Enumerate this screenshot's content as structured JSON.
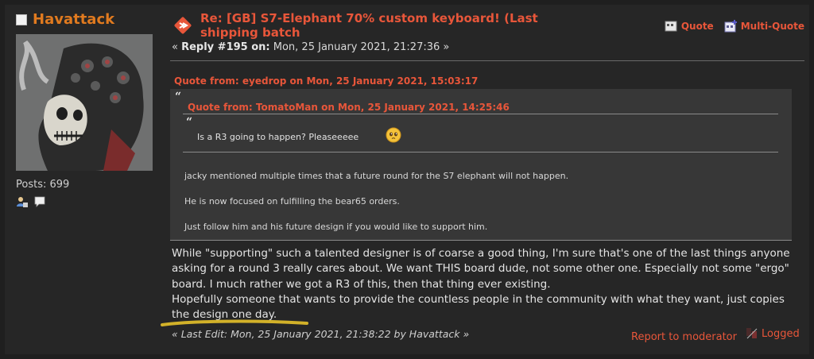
{
  "poster": {
    "username": "Havattack",
    "posts": "Posts: 699",
    "icons": [
      "profile-icon",
      "message-icon"
    ]
  },
  "post": {
    "subject": "Re: [GB] S7-Elephant 70% custom keyboard! (Last shipping batch",
    "reply_prefix": "« ",
    "reply_label": "Reply #195 on:",
    "reply_date": " Mon, 25 January 2021, 21:27:36 »"
  },
  "buttons": {
    "quote": "Quote",
    "multi_quote": "Multi-Quote"
  },
  "quote_outer": {
    "header": "Quote from: eyedrop on Mon, 25 January 2021, 15:03:17",
    "lines": [
      "jacky mentioned multiple times that a future round for the S7 elephant will not happen.",
      "He is now focused on fulfilling the bear65 orders.",
      "Just follow him and his future design if you would like to support him."
    ]
  },
  "quote_inner": {
    "header": "Quote from: TomatoMan on Mon, 25 January 2021, 14:25:46",
    "text": "Is a R3 going to happen? Pleaseeeee",
    "emoji": "pleading-face"
  },
  "body": {
    "paragraph_1": "While \"supporting\" such a talented designer is of coarse a good thing, I'm sure that's one of the last things anyone asking for a round 3 really cares about. We want THIS board dude, not some other one. Especially not some  \"ergo\" board. I much rather we got a R3 of this, then that thing ever existing.",
    "paragraph_2": "Hopefully someone that wants to provide the countless people in the community with what they want,  just copies the design one day."
  },
  "footer": {
    "last_edit": "« Last Edit: Mon, 25 January 2021, 21:38:22 by Havattack »",
    "report": "Report to moderator",
    "logged": "Logged"
  },
  "colors": {
    "accent": "#e8563a",
    "username": "#e07a1f",
    "highlight_underline": "#e6c12a"
  }
}
